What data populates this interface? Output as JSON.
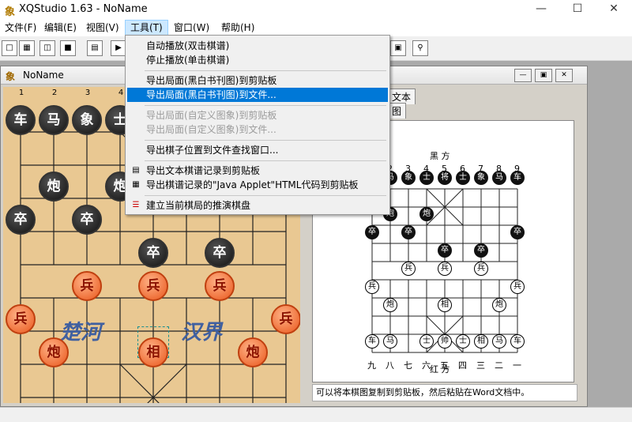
{
  "window": {
    "title": "XQStudio 1.63 - NoName",
    "app_icon": "象"
  },
  "menubar": [
    {
      "label": "文件(F)"
    },
    {
      "label": "编辑(E)"
    },
    {
      "label": "视图(V)"
    },
    {
      "label": "工具(T)"
    },
    {
      "label": "窗口(W)"
    },
    {
      "label": "帮助(H)"
    }
  ],
  "tools_menu": {
    "items": [
      {
        "label": "自动播放(双击棋谱)"
      },
      {
        "label": "停止播放(单击棋谱)"
      },
      {
        "label": "导出局面(黑白书刊图)到剪贴板"
      },
      {
        "label": "导出局面(黑白书刊图)到文件..."
      },
      {
        "label": "导出局面(自定义图象)到剪贴板"
      },
      {
        "label": "导出局面(自定义图象)到文件..."
      },
      {
        "label": "导出棋子位置到文件查找窗口..."
      },
      {
        "label": "导出文本棋谱记录到剪贴板"
      },
      {
        "label": "导出棋谱记录的\"Java Applet\"HTML代码到剪贴板"
      },
      {
        "label": "建立当前棋局的推演棋盘"
      }
    ]
  },
  "child_window": {
    "title": "NoName",
    "icon": "象"
  },
  "board": {
    "col_numbers": [
      "1",
      "2",
      "3",
      "4"
    ],
    "river_left": "楚河",
    "river_right": "汉界",
    "black_pieces": [
      {
        "t": "车",
        "c": 0,
        "r": 0
      },
      {
        "t": "马",
        "c": 1,
        "r": 0
      },
      {
        "t": "象",
        "c": 2,
        "r": 0
      },
      {
        "t": "士",
        "c": 3,
        "r": 0
      },
      {
        "t": "炮",
        "c": 1,
        "r": 2
      },
      {
        "t": "炮",
        "c": 3,
        "r": 2
      },
      {
        "t": "卒",
        "c": 0,
        "r": 3
      },
      {
        "t": "卒",
        "c": 2,
        "r": 3
      },
      {
        "t": "卒",
        "c": 4,
        "r": 4
      },
      {
        "t": "卒",
        "c": 6,
        "r": 4
      }
    ],
    "red_pieces": [
      {
        "t": "兵",
        "c": 2,
        "r": 5
      },
      {
        "t": "兵",
        "c": 4,
        "r": 5
      },
      {
        "t": "兵",
        "c": 6,
        "r": 5
      },
      {
        "t": "兵",
        "c": 0,
        "r": 6
      },
      {
        "t": "兵",
        "c": 8,
        "r": 6
      },
      {
        "t": "炮",
        "c": 1,
        "r": 7
      },
      {
        "t": "相",
        "c": 4,
        "r": 7
      },
      {
        "t": "炮",
        "c": 7,
        "r": 7
      },
      {
        "t": "车",
        "c": 0,
        "r": 9
      },
      {
        "t": "马",
        "c": 1,
        "r": 9
      },
      {
        "t": "士",
        "c": 3,
        "r": 9
      },
      {
        "t": "帅",
        "c": 4,
        "r": 9
      },
      {
        "t": "士",
        "c": 5,
        "r": 9
      },
      {
        "t": "相",
        "c": 6,
        "r": 9
      },
      {
        "t": "马",
        "c": 7,
        "r": 9
      },
      {
        "t": "车",
        "c": 8,
        "r": 9
      }
    ]
  },
  "right_pane": {
    "tab_text": "文本",
    "tab_diagram": "图",
    "diagram_top_label": "黑 方",
    "diagram_bottom_label": "红 方",
    "top_numbers": [
      "1",
      "2",
      "3",
      "4",
      "5",
      "6",
      "7",
      "8",
      "9"
    ],
    "bottom_numbers": [
      "九",
      "八",
      "七",
      "六",
      "五",
      "四",
      "三",
      "二",
      "一"
    ],
    "black": [
      {
        "t": "车",
        "c": 0,
        "r": 0
      },
      {
        "t": "马",
        "c": 1,
        "r": 0
      },
      {
        "t": "象",
        "c": 2,
        "r": 0
      },
      {
        "t": "士",
        "c": 3,
        "r": 0
      },
      {
        "t": "将",
        "c": 4,
        "r": 0
      },
      {
        "t": "士",
        "c": 5,
        "r": 0
      },
      {
        "t": "象",
        "c": 6,
        "r": 0
      },
      {
        "t": "马",
        "c": 7,
        "r": 0
      },
      {
        "t": "车",
        "c": 8,
        "r": 0
      },
      {
        "t": "炮",
        "c": 1,
        "r": 2
      },
      {
        "t": "炮",
        "c": 3,
        "r": 2
      },
      {
        "t": "卒",
        "c": 0,
        "r": 3
      },
      {
        "t": "卒",
        "c": 2,
        "r": 3
      },
      {
        "t": "卒",
        "c": 8,
        "r": 3
      },
      {
        "t": "卒",
        "c": 4,
        "r": 4
      },
      {
        "t": "卒",
        "c": 6,
        "r": 4
      }
    ],
    "red": [
      {
        "t": "兵",
        "c": 2,
        "r": 5
      },
      {
        "t": "兵",
        "c": 4,
        "r": 5
      },
      {
        "t": "兵",
        "c": 6,
        "r": 5
      },
      {
        "t": "兵",
        "c": 0,
        "r": 6
      },
      {
        "t": "兵",
        "c": 8,
        "r": 6
      },
      {
        "t": "炮",
        "c": 1,
        "r": 7
      },
      {
        "t": "相",
        "c": 4,
        "r": 7
      },
      {
        "t": "炮",
        "c": 7,
        "r": 7
      },
      {
        "t": "车",
        "c": 0,
        "r": 9
      },
      {
        "t": "马",
        "c": 1,
        "r": 9
      },
      {
        "t": "士",
        "c": 3,
        "r": 9
      },
      {
        "t": "帅",
        "c": 4,
        "r": 9
      },
      {
        "t": "士",
        "c": 5,
        "r": 9
      },
      {
        "t": "相",
        "c": 6,
        "r": 9
      },
      {
        "t": "马",
        "c": 7,
        "r": 9
      },
      {
        "t": "车",
        "c": 8,
        "r": 9
      }
    ],
    "hint": "可以将本棋图复制到剪贴板，然后粘贴在Word文档中。"
  }
}
